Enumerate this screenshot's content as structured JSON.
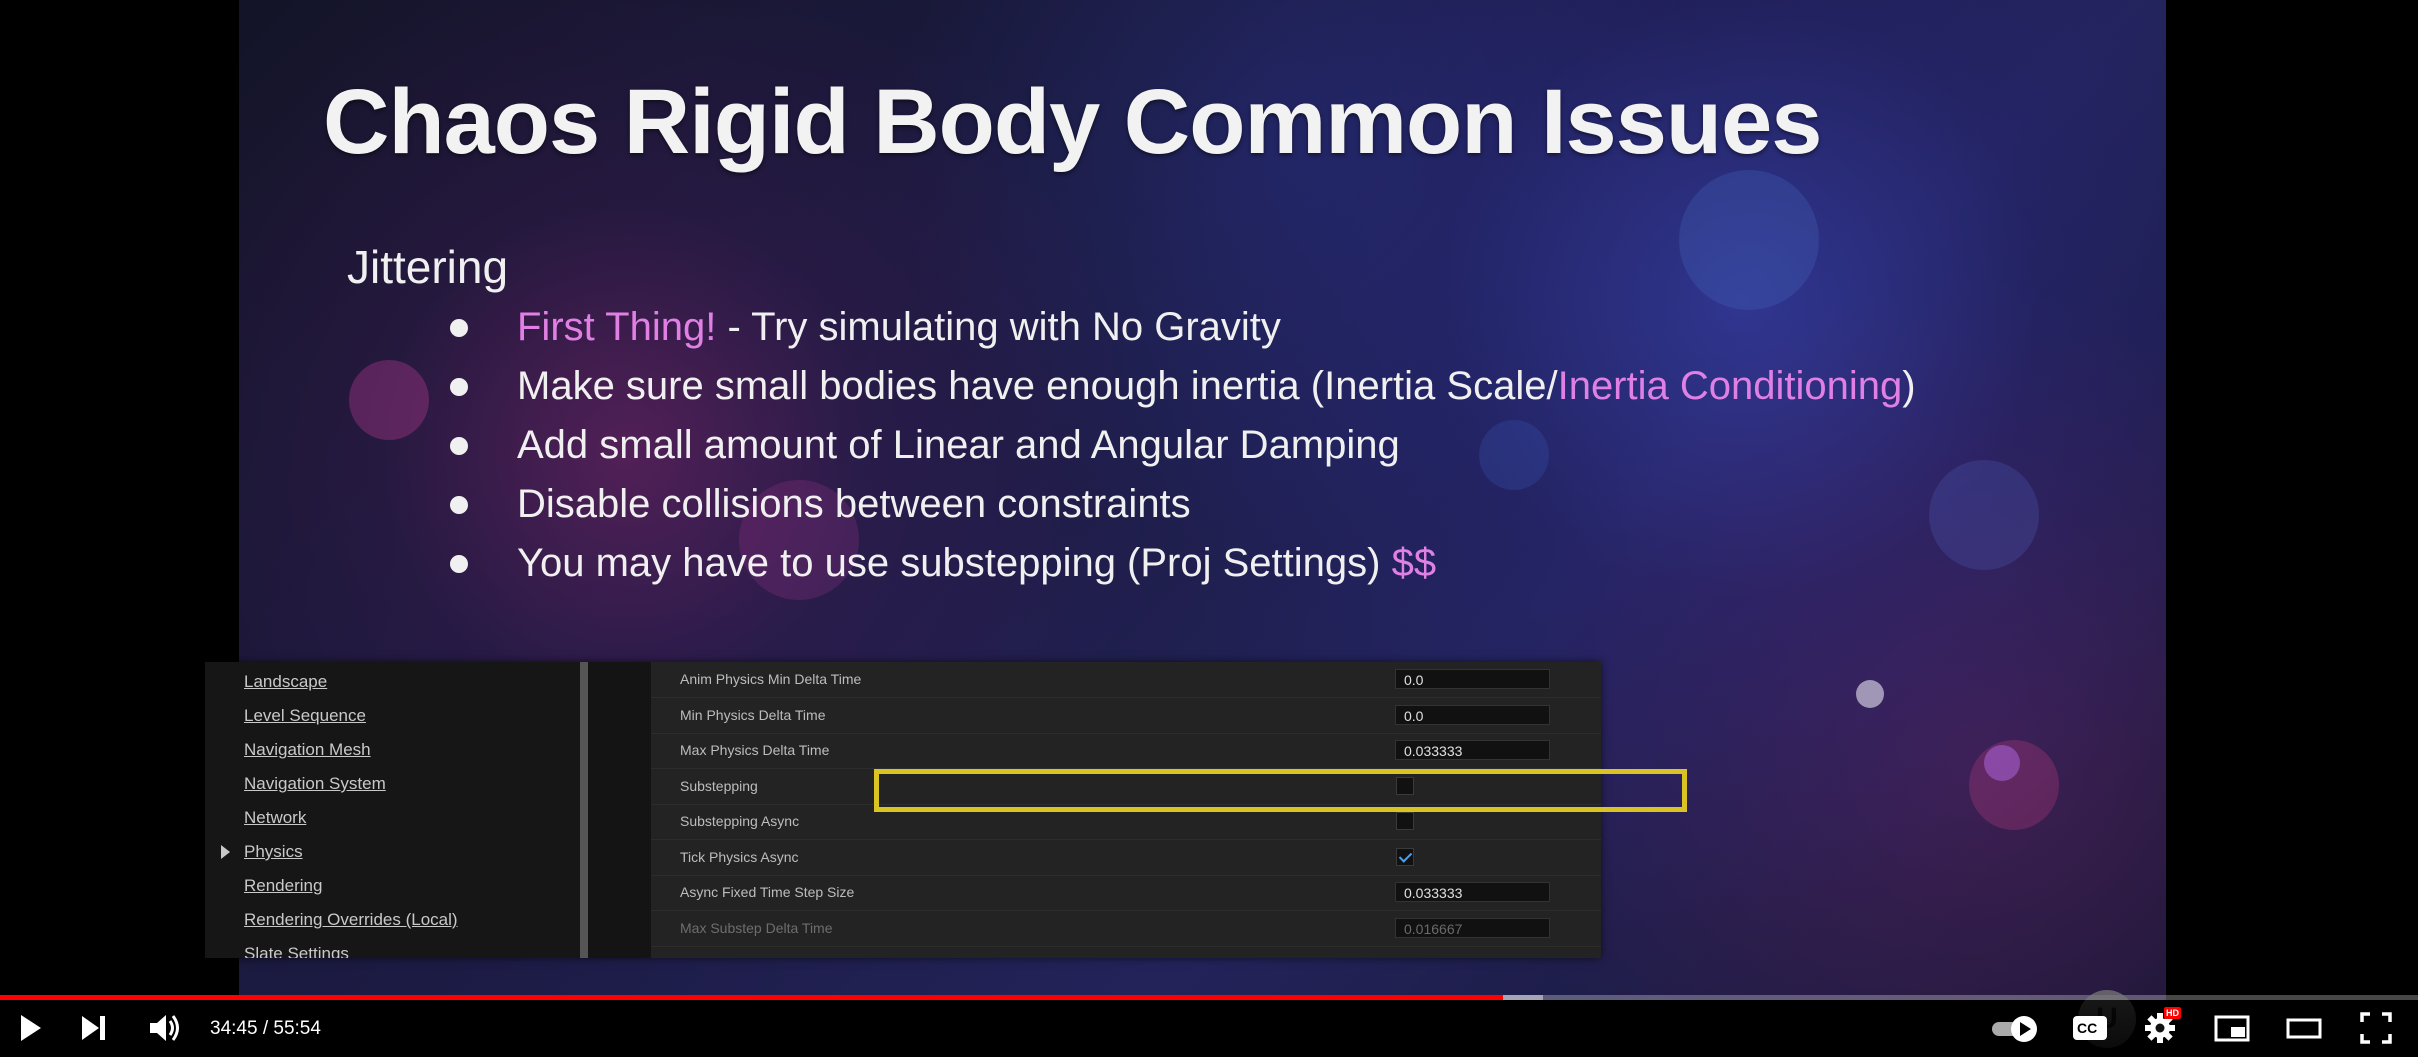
{
  "slide": {
    "title": "Chaos Rigid Body Common Issues",
    "section": "Jittering",
    "bullets": [
      {
        "parts": [
          {
            "text": "First Thing!",
            "highlight": true
          },
          {
            "text": " - Try simulating with No Gravity",
            "highlight": false
          }
        ]
      },
      {
        "parts": [
          {
            "text": "Make sure small bodies have enough inertia (Inertia Scale/",
            "highlight": false
          },
          {
            "text": "Inertia Conditioning",
            "highlight": true
          },
          {
            "text": ")",
            "highlight": false
          }
        ]
      },
      {
        "parts": [
          {
            "text": "Add small amount of Linear and Angular Damping",
            "highlight": false
          }
        ]
      },
      {
        "parts": [
          {
            "text": "Disable collisions between constraints",
            "highlight": false
          }
        ]
      },
      {
        "parts": [
          {
            "text": "You may have to use substepping (Proj Settings) ",
            "highlight": false
          },
          {
            "text": "$$",
            "highlight": true
          }
        ]
      }
    ],
    "highlight_color": "#e080e4"
  },
  "editor": {
    "nav_items": [
      {
        "label": "Landscape",
        "expanded_arrow": false
      },
      {
        "label": "Level Sequence",
        "expanded_arrow": false
      },
      {
        "label": "Navigation Mesh",
        "expanded_arrow": false
      },
      {
        "label": "Navigation System",
        "expanded_arrow": false
      },
      {
        "label": "Network",
        "expanded_arrow": false
      },
      {
        "label": "Physics",
        "expanded_arrow": true
      },
      {
        "label": "Rendering",
        "expanded_arrow": false
      },
      {
        "label": "Rendering Overrides (Local)",
        "expanded_arrow": false
      },
      {
        "label": "Slate Settings",
        "expanded_arrow": false
      }
    ],
    "properties": [
      {
        "label": "Anim Physics Min Delta Time",
        "kind": "number",
        "value": "0.0",
        "disabled": false
      },
      {
        "label": "Min Physics Delta Time",
        "kind": "number",
        "value": "0.0",
        "disabled": false
      },
      {
        "label": "Max Physics Delta Time",
        "kind": "number",
        "value": "0.033333",
        "disabled": false
      },
      {
        "label": "Substepping",
        "kind": "checkbox",
        "checked": false,
        "disabled": false
      },
      {
        "label": "Substepping Async",
        "kind": "checkbox",
        "checked": false,
        "disabled": false
      },
      {
        "label": "Tick Physics Async",
        "kind": "checkbox",
        "checked": true,
        "disabled": false
      },
      {
        "label": "Async Fixed Time Step Size",
        "kind": "number",
        "value": "0.033333",
        "disabled": false
      },
      {
        "label": "Max Substep Delta Time",
        "kind": "number",
        "value": "0.016667",
        "disabled": true
      }
    ],
    "highlight_color": "#d9c423"
  },
  "player": {
    "current_time": "34:45",
    "duration": "55:54",
    "time_separator": " / ",
    "progress_fraction": 0.6216,
    "buffered_fraction": 0.638,
    "progress_color": "#ff0000",
    "icons": {
      "play": "play-icon",
      "next": "next-icon",
      "volume": "volume-icon",
      "autoplay": "autoplay-toggle-icon",
      "captions": "captions-icon",
      "settings": "gear-icon",
      "miniplayer": "miniplayer-icon",
      "theater": "theater-icon",
      "fullscreen": "fullscreen-icon"
    },
    "captions_label": "CC",
    "settings_badge": "HD"
  }
}
